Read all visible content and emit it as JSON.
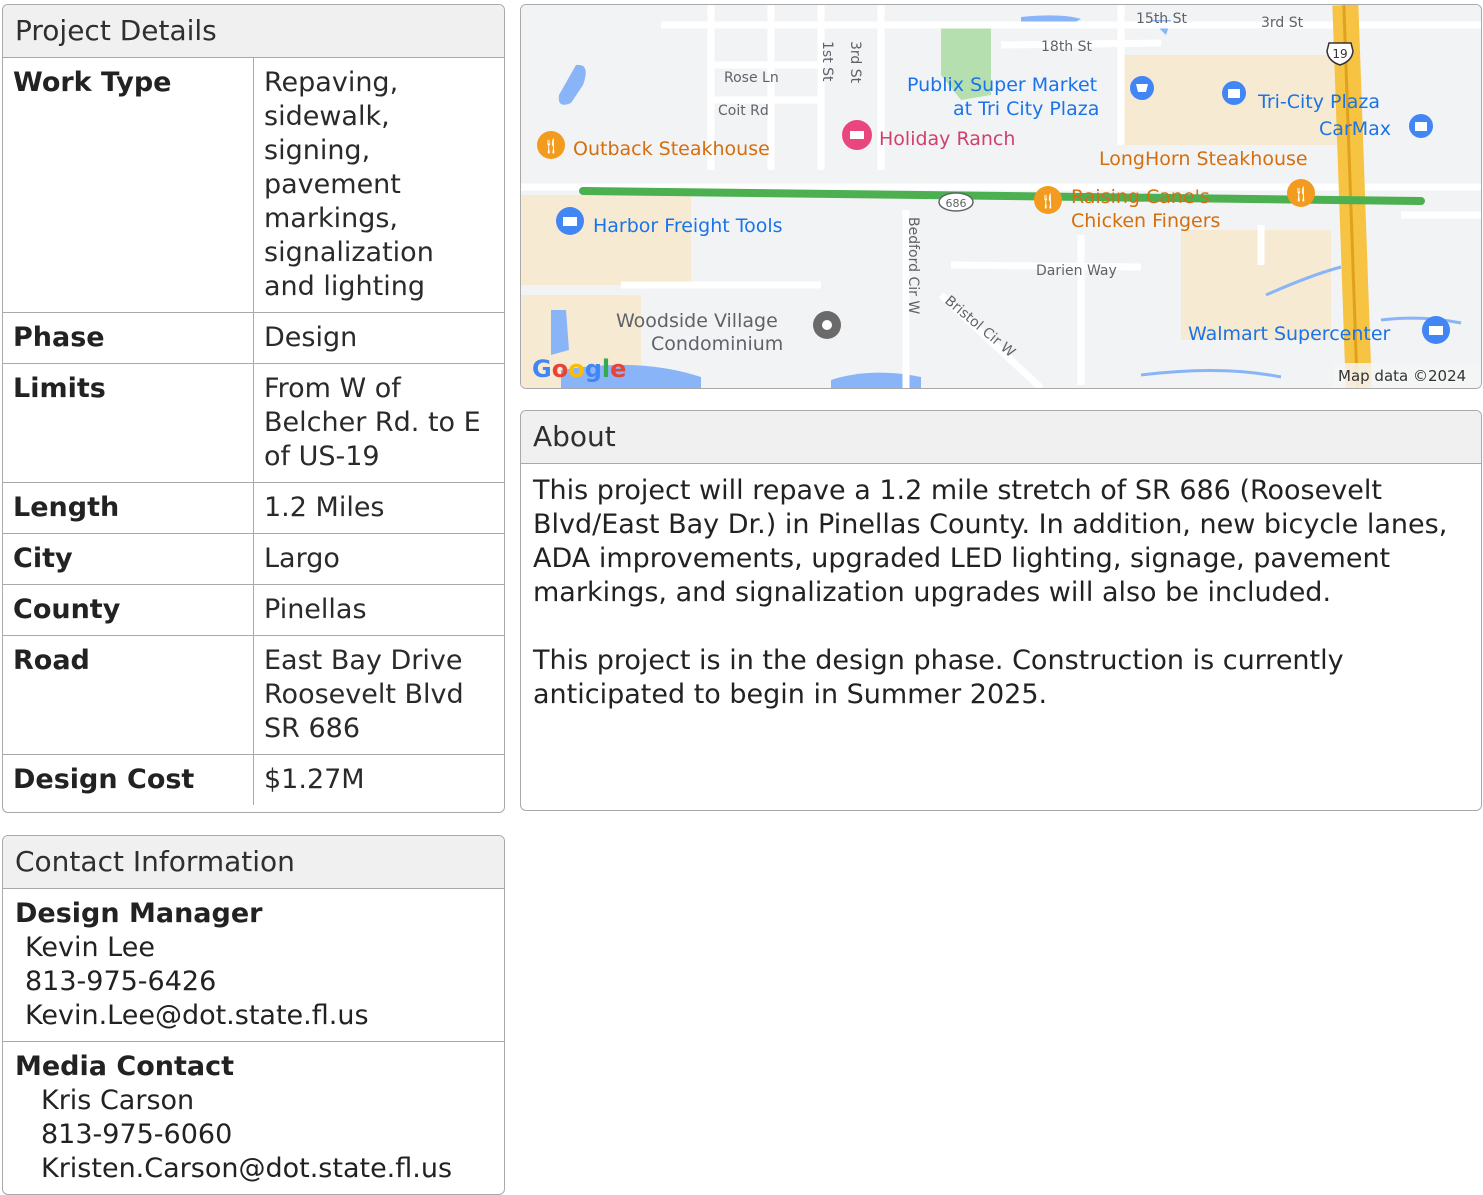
{
  "details": {
    "title": "Project Details",
    "rows": [
      {
        "key": "Work Type",
        "value": "Repaving, sidewalk, signing, pavement markings, signalization and lighting"
      },
      {
        "key": "Phase",
        "value": "Design"
      },
      {
        "key": "Limits",
        "value": "From W of Belcher Rd. to E of US-19"
      },
      {
        "key": "Length",
        "value": "1.2 Miles"
      },
      {
        "key": "City",
        "value": "Largo"
      },
      {
        "key": "County",
        "value": "Pinellas"
      },
      {
        "key": "Road",
        "value": [
          "East Bay Drive",
          "Roosevelt Blvd",
          "SR 686"
        ]
      },
      {
        "key": "Design Cost",
        "value": "$1.27M"
      }
    ]
  },
  "map": {
    "streets": [
      "15th St",
      "3rd St",
      "18th St",
      "1st St",
      "3rd St",
      "Rose Ln",
      "Coit Rd",
      "Darien Way",
      "Bedford Cir W",
      "Bristol Cir W"
    ],
    "places": {
      "publix": [
        "Publix Super Market",
        "at Tri City Plaza"
      ],
      "tri_city": "Tri-City Plaza",
      "carmax": "CarMax",
      "outback": "Outback Steakhouse",
      "holiday": "Holiday Ranch",
      "longhorn": "LongHorn Steakhouse",
      "canes": [
        "Raising Cane's",
        "Chicken Fingers"
      ],
      "harbor": "Harbor Freight Tools",
      "woodside": [
        "Woodside Village",
        "Condominium"
      ],
      "walmart": "Walmart Supercenter"
    },
    "shields": {
      "sr": "686",
      "us": "19"
    },
    "google": "Google",
    "attribution": "Map data ©2024",
    "colors": {
      "route": "#4caf50",
      "road_major": "#f6c342",
      "water": "#8ab4f8",
      "park": "#b6dfb0",
      "commercial": "#f7ead3",
      "food": "#f29b1f",
      "shop": "#4285f4",
      "lodging": "#e8467c",
      "landmark": "#6a6a6a"
    }
  },
  "about": {
    "title": "About",
    "paragraphs": [
      "This project will repave a 1.2 mile stretch of SR 686 (Roosevelt Blvd/East Bay Dr.) in Pinellas County. In addition, new bicycle lanes, ADA improvements, upgraded LED lighting, signage, pavement markings, and signalization upgrades will also be included.",
      "This project is in the design phase. Construction is currently anticipated to begin in Summer 2025."
    ]
  },
  "contact": {
    "title": "Contact Information",
    "people": [
      {
        "role": "Design Manager",
        "name": "Kevin Lee",
        "phone": "813-975-6426",
        "email": "Kevin.Lee@dot.state.fl.us"
      },
      {
        "role": "Media Contact",
        "name": "Kris Carson",
        "phone": "813-975-6060",
        "email": "Kristen.Carson@dot.state.fl.us"
      }
    ]
  }
}
